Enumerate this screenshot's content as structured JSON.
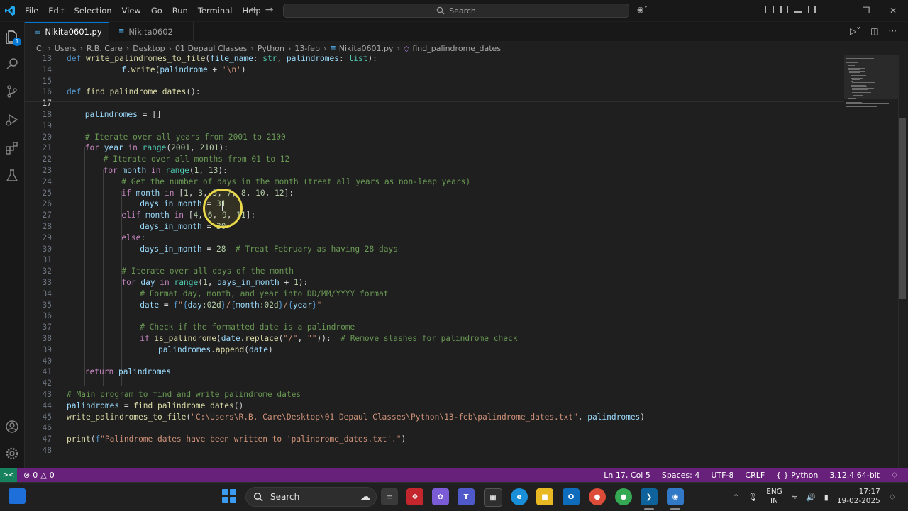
{
  "menu": [
    "File",
    "Edit",
    "Selection",
    "View",
    "Go",
    "Run",
    "Terminal",
    "Help"
  ],
  "search_label": "Search",
  "tabs": [
    {
      "label": "Nikita0601.py",
      "active": true,
      "modified": true
    },
    {
      "label": "Nikita0602",
      "active": false,
      "modified": false
    }
  ],
  "breadcrumb": [
    "C:",
    "Users",
    "R.B. Care",
    "Desktop",
    "01 Depaul Classes",
    "Python",
    "13-feb",
    "Nikita0601.py",
    "find_palindrome_dates"
  ],
  "code_lines": [
    {
      "n": "13",
      "indent": 0,
      "tokens": [
        [
          "kd",
          "def "
        ],
        [
          "fn",
          "write_palindromes_to_file"
        ],
        [
          "",
          "("
        ],
        [
          "var",
          "file_name"
        ],
        [
          "",
          ": "
        ],
        [
          "bi",
          "str"
        ],
        [
          "",
          ", "
        ],
        [
          "var",
          "palindromes"
        ],
        [
          "",
          ": "
        ],
        [
          "bi",
          "list"
        ],
        [
          "",
          "):"
        ]
      ]
    },
    {
      "n": "14",
      "indent": 3,
      "tokens": [
        [
          "var",
          "f"
        ],
        [
          "",
          "."
        ],
        [
          "fn",
          "write"
        ],
        [
          "",
          "("
        ],
        [
          "var",
          "palindrome"
        ],
        [
          "",
          " + "
        ],
        [
          "str",
          "'\\n'"
        ],
        [
          "",
          ")"
        ]
      ]
    },
    {
      "n": "15",
      "indent": 0,
      "tokens": []
    },
    {
      "n": "16",
      "indent": 0,
      "tokens": [
        [
          "kd",
          "def "
        ],
        [
          "fn",
          "find_palindrome_dates"
        ],
        [
          "",
          "():"
        ]
      ]
    },
    {
      "n": "17",
      "indent": 0,
      "tokens": []
    },
    {
      "n": "18",
      "indent": 1,
      "tokens": [
        [
          "var",
          "palindromes"
        ],
        [
          "",
          " = []"
        ]
      ]
    },
    {
      "n": "19",
      "indent": 0,
      "tokens": []
    },
    {
      "n": "20",
      "indent": 1,
      "tokens": [
        [
          "com",
          "# Iterate over all years from 2001 to 2100"
        ]
      ]
    },
    {
      "n": "21",
      "indent": 1,
      "tokens": [
        [
          "kw",
          "for "
        ],
        [
          "var",
          "year"
        ],
        [
          "kw",
          " in "
        ],
        [
          "bi",
          "range"
        ],
        [
          "",
          "("
        ],
        [
          "num",
          "2001"
        ],
        [
          "",
          ", "
        ],
        [
          "num",
          "2101"
        ],
        [
          "",
          "):"
        ]
      ]
    },
    {
      "n": "22",
      "indent": 2,
      "tokens": [
        [
          "com",
          "# Iterate over all months from 01 to 12"
        ]
      ]
    },
    {
      "n": "23",
      "indent": 2,
      "tokens": [
        [
          "kw",
          "for "
        ],
        [
          "var",
          "month"
        ],
        [
          "kw",
          " in "
        ],
        [
          "bi",
          "range"
        ],
        [
          "",
          "("
        ],
        [
          "num",
          "1"
        ],
        [
          "",
          ", "
        ],
        [
          "num",
          "13"
        ],
        [
          "",
          "):"
        ]
      ]
    },
    {
      "n": "24",
      "indent": 3,
      "tokens": [
        [
          "com",
          "# Get the number of days in the month (treat all years as non-leap years)"
        ]
      ]
    },
    {
      "n": "25",
      "indent": 3,
      "tokens": [
        [
          "kw",
          "if "
        ],
        [
          "var",
          "month"
        ],
        [
          "kw",
          " in "
        ],
        [
          "",
          "["
        ],
        [
          "num",
          "1"
        ],
        [
          "",
          ", "
        ],
        [
          "num",
          "3"
        ],
        [
          "",
          ", "
        ],
        [
          "num",
          "5"
        ],
        [
          "",
          ", "
        ],
        [
          "num",
          "7"
        ],
        [
          "",
          ", "
        ],
        [
          "num",
          "8"
        ],
        [
          "",
          ", "
        ],
        [
          "num",
          "10"
        ],
        [
          "",
          ", "
        ],
        [
          "num",
          "12"
        ],
        [
          "",
          "]:"
        ]
      ]
    },
    {
      "n": "26",
      "indent": 4,
      "tokens": [
        [
          "var",
          "days_in_month"
        ],
        [
          "",
          " = "
        ],
        [
          "num",
          "31"
        ]
      ]
    },
    {
      "n": "27",
      "indent": 3,
      "tokens": [
        [
          "kw",
          "elif "
        ],
        [
          "var",
          "month"
        ],
        [
          "kw",
          " in "
        ],
        [
          "",
          "["
        ],
        [
          "num",
          "4"
        ],
        [
          "",
          ", "
        ],
        [
          "num",
          "6"
        ],
        [
          "",
          ", "
        ],
        [
          "num",
          "9"
        ],
        [
          "",
          ", "
        ],
        [
          "num",
          "11"
        ],
        [
          "",
          "]:"
        ]
      ]
    },
    {
      "n": "28",
      "indent": 4,
      "tokens": [
        [
          "var",
          "days_in_month"
        ],
        [
          "",
          " = "
        ],
        [
          "num",
          "30"
        ]
      ]
    },
    {
      "n": "29",
      "indent": 3,
      "tokens": [
        [
          "kw",
          "else"
        ],
        [
          "",
          ":"
        ]
      ]
    },
    {
      "n": "30",
      "indent": 4,
      "tokens": [
        [
          "var",
          "days_in_month"
        ],
        [
          "",
          " = "
        ],
        [
          "num",
          "28"
        ],
        [
          "",
          "  "
        ],
        [
          "com",
          "# Treat February as having 28 days"
        ]
      ]
    },
    {
      "n": "31",
      "indent": 0,
      "tokens": []
    },
    {
      "n": "32",
      "indent": 3,
      "tokens": [
        [
          "com",
          "# Iterate over all days of the month"
        ]
      ]
    },
    {
      "n": "33",
      "indent": 3,
      "tokens": [
        [
          "kw",
          "for "
        ],
        [
          "var",
          "day"
        ],
        [
          "kw",
          " in "
        ],
        [
          "bi",
          "range"
        ],
        [
          "",
          "("
        ],
        [
          "num",
          "1"
        ],
        [
          "",
          ", "
        ],
        [
          "var",
          "days_in_month"
        ],
        [
          "",
          " + "
        ],
        [
          "num",
          "1"
        ],
        [
          "",
          "):"
        ]
      ]
    },
    {
      "n": "34",
      "indent": 4,
      "tokens": [
        [
          "com",
          "# Format day, month, and year into DD/MM/YYYY format"
        ]
      ]
    },
    {
      "n": "35",
      "indent": 4,
      "tokens": [
        [
          "var",
          "date"
        ],
        [
          "",
          " = "
        ],
        [
          "kd",
          "f"
        ],
        [
          "str",
          "\""
        ],
        [
          "kd",
          "{"
        ],
        [
          "var",
          "day"
        ],
        [
          "num",
          ":02d"
        ],
        [
          "kd",
          "}"
        ],
        [
          "str",
          "/"
        ],
        [
          "kd",
          "{"
        ],
        [
          "var",
          "month"
        ],
        [
          "num",
          ":02d"
        ],
        [
          "kd",
          "}"
        ],
        [
          "str",
          "/"
        ],
        [
          "kd",
          "{"
        ],
        [
          "var",
          "year"
        ],
        [
          "kd",
          "}"
        ],
        [
          "str",
          "\""
        ]
      ]
    },
    {
      "n": "36",
      "indent": 0,
      "tokens": []
    },
    {
      "n": "37",
      "indent": 4,
      "tokens": [
        [
          "com",
          "# Check if the formatted date is a palindrome"
        ]
      ]
    },
    {
      "n": "38",
      "indent": 4,
      "tokens": [
        [
          "kw",
          "if "
        ],
        [
          "fn",
          "is_palindrome"
        ],
        [
          "",
          "("
        ],
        [
          "var",
          "date"
        ],
        [
          "",
          "."
        ],
        [
          "fn",
          "replace"
        ],
        [
          "",
          "("
        ],
        [
          "str",
          "\"/\""
        ],
        [
          "",
          ", "
        ],
        [
          "str",
          "\"\""
        ],
        [
          "",
          "))"
        ],
        [
          "",
          ":  "
        ],
        [
          "com",
          "# Remove slashes for palindrome check"
        ]
      ]
    },
    {
      "n": "39",
      "indent": 5,
      "tokens": [
        [
          "var",
          "palindromes"
        ],
        [
          "",
          "."
        ],
        [
          "fn",
          "append"
        ],
        [
          "",
          "("
        ],
        [
          "var",
          "date"
        ],
        [
          "",
          ")"
        ]
      ]
    },
    {
      "n": "40",
      "indent": 0,
      "tokens": []
    },
    {
      "n": "41",
      "indent": 1,
      "tokens": [
        [
          "kw",
          "return "
        ],
        [
          "var",
          "palindromes"
        ]
      ]
    },
    {
      "n": "42",
      "indent": 0,
      "tokens": []
    },
    {
      "n": "43",
      "indent": 0,
      "tokens": [
        [
          "com",
          "# Main program to find and write palindrome dates"
        ]
      ]
    },
    {
      "n": "44",
      "indent": 0,
      "tokens": [
        [
          "var",
          "palindromes"
        ],
        [
          "",
          " = "
        ],
        [
          "fn",
          "find_palindrome_dates"
        ],
        [
          "",
          "()"
        ]
      ]
    },
    {
      "n": "45",
      "indent": 0,
      "tokens": [
        [
          "fn",
          "write_palindromes_to_file"
        ],
        [
          "",
          "("
        ],
        [
          "str",
          "\"C:\\Users\\R.B. Care\\Desktop\\01 Depaul Classes\\Python\\13-feb\\palindrome_dates.txt\""
        ],
        [
          "",
          ", "
        ],
        [
          "var",
          "palindromes"
        ],
        [
          "",
          ")"
        ]
      ]
    },
    {
      "n": "46",
      "indent": 0,
      "tokens": []
    },
    {
      "n": "47",
      "indent": 0,
      "tokens": [
        [
          "fn",
          "print"
        ],
        [
          "",
          "("
        ],
        [
          "kd",
          "f"
        ],
        [
          "str",
          "\"Palindrome dates have been written to 'palindrome_dates.txt'.\""
        ],
        [
          "",
          ")"
        ]
      ]
    },
    {
      "n": "48",
      "indent": 0,
      "tokens": []
    }
  ],
  "current_line": "17",
  "status": {
    "errors": "0",
    "warnings": "0",
    "position": "Ln 17, Col 5",
    "spaces": "Spaces: 4",
    "encoding": "UTF-8",
    "eol": "CRLF",
    "language": "Python",
    "interpreter": "3.12.4 64-bit"
  },
  "taskbar": {
    "search_label": "Search",
    "lang_top": "ENG",
    "lang_bottom": "IN",
    "time": "17:17",
    "date": "19-02-2025"
  },
  "colors": {
    "statusbar": "#68217a",
    "accent": "#0078d4",
    "cursor_highlight": "#e8d84a"
  }
}
